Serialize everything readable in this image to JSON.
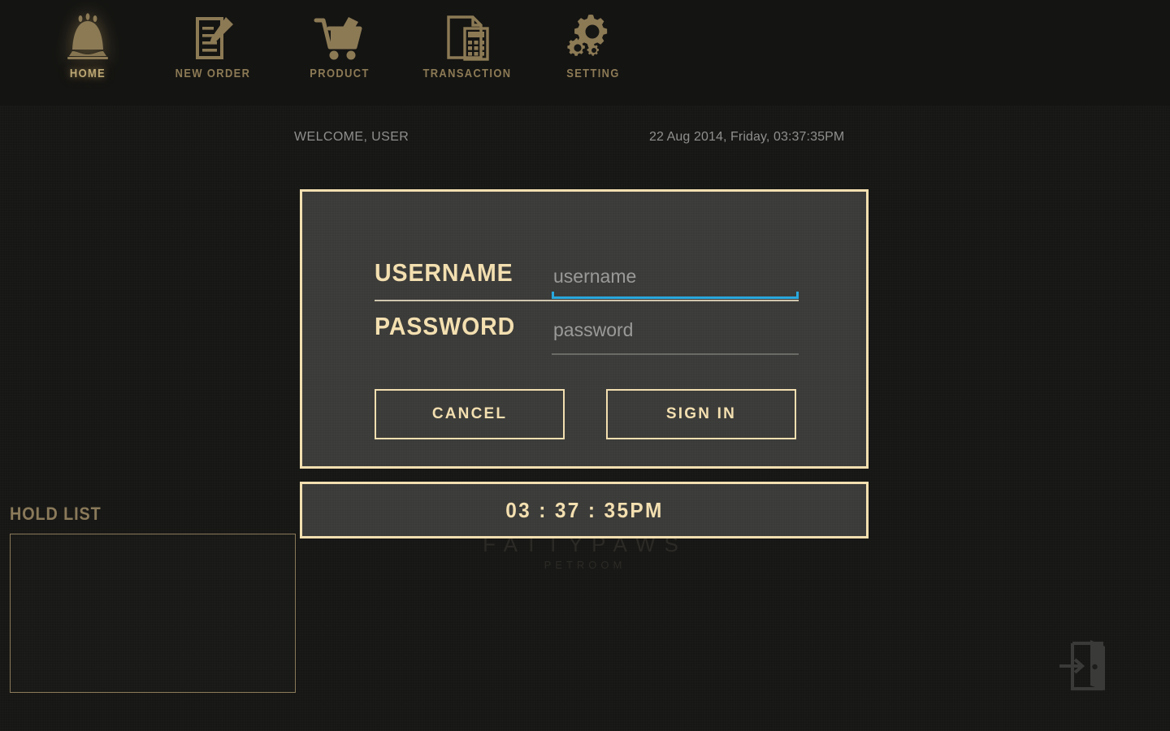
{
  "nav": {
    "items": [
      {
        "label": "HOME",
        "icon": "bell-icon",
        "active": true
      },
      {
        "label": "NEW ORDER",
        "icon": "document-pencil-icon",
        "active": false
      },
      {
        "label": "PRODUCT",
        "icon": "shopping-cart-icon",
        "active": false
      },
      {
        "label": "TRANSACTION",
        "icon": "document-calculator-icon",
        "active": false
      },
      {
        "label": "SETTING",
        "icon": "gears-icon",
        "active": false
      }
    ]
  },
  "status": {
    "welcome": "WELCOME, USER",
    "datetime": "22 Aug 2014, Friday, 03:37:35PM"
  },
  "watermark": {
    "main": "FATTYPAWS",
    "sub": "PETROOM"
  },
  "hold_list": {
    "title": "HOLD LIST",
    "items": []
  },
  "login": {
    "username_label": "USERNAME",
    "username_value": "",
    "username_placeholder": "username",
    "password_label": "PASSWORD",
    "password_value": "",
    "password_placeholder": "password",
    "cancel_label": "CANCEL",
    "signin_label": "SIGN IN",
    "focused_field": "username"
  },
  "clock": {
    "text": "03 : 37 : 35PM"
  },
  "exit": {
    "icon": "exit-door-icon"
  },
  "colors": {
    "accent_cream": "#f3dfb0",
    "accent_bronze": "#8a7a5a",
    "page_background": "#161614",
    "panel_background": "#3a3a38",
    "focus_blue": "#29a8dd",
    "muted_text": "#8f8f8d"
  }
}
